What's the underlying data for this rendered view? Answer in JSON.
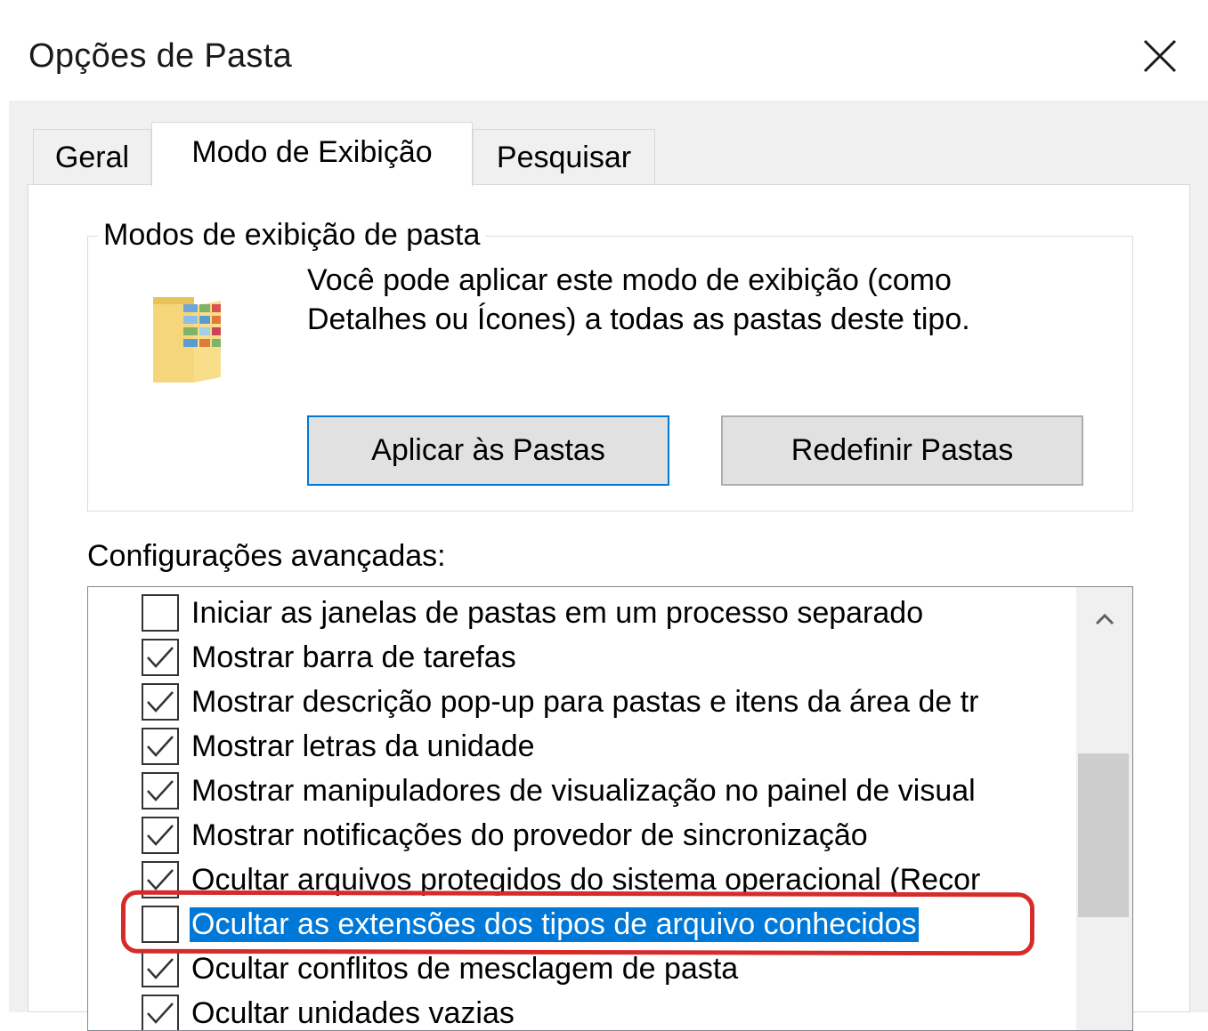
{
  "window": {
    "title": "Opções de Pasta",
    "close_icon": "close-icon"
  },
  "tabs": [
    {
      "label": "Geral",
      "active": false
    },
    {
      "label": "Modo de Exibição",
      "active": true
    },
    {
      "label": "Pesquisar",
      "active": false
    }
  ],
  "folder_views": {
    "legend": "Modos de exibição de pasta",
    "icon": "folder-pictures-icon",
    "description_line1": "Você pode aplicar este modo de exibição (como",
    "description_line2": "Detalhes ou Ícones) a todas as pastas deste tipo.",
    "apply_button": "Aplicar às Pastas",
    "reset_button": "Redefinir Pastas"
  },
  "advanced": {
    "label": "Configurações avançadas:",
    "items": [
      {
        "label": "Iniciar as janelas de pastas em um processo separado",
        "checked": false,
        "selected": false
      },
      {
        "label": "Mostrar barra de tarefas",
        "checked": true,
        "selected": false
      },
      {
        "label": "Mostrar descrição pop-up para pastas e itens da área de tr",
        "checked": true,
        "selected": false
      },
      {
        "label": "Mostrar letras da unidade",
        "checked": true,
        "selected": false
      },
      {
        "label": "Mostrar manipuladores de visualização no painel de visual",
        "checked": true,
        "selected": false
      },
      {
        "label": "Mostrar notificações do provedor de sincronização",
        "checked": true,
        "selected": false
      },
      {
        "label": "Ocultar arquivos protegidos do sistema operacional (Recor",
        "checked": true,
        "selected": false
      },
      {
        "label": "Ocultar as extensões dos tipos de arquivo conhecidos",
        "checked": false,
        "selected": true
      },
      {
        "label": "Ocultar conflitos de mesclagem de pasta",
        "checked": true,
        "selected": false
      },
      {
        "label": "Ocultar unidades vazias",
        "checked": true,
        "selected": false
      }
    ],
    "scroll_up_icon": "chevron-up-icon"
  },
  "colors": {
    "selection": "#0078d7",
    "highlight_ring": "#d62b2b",
    "default_button_border": "#0078d7"
  }
}
